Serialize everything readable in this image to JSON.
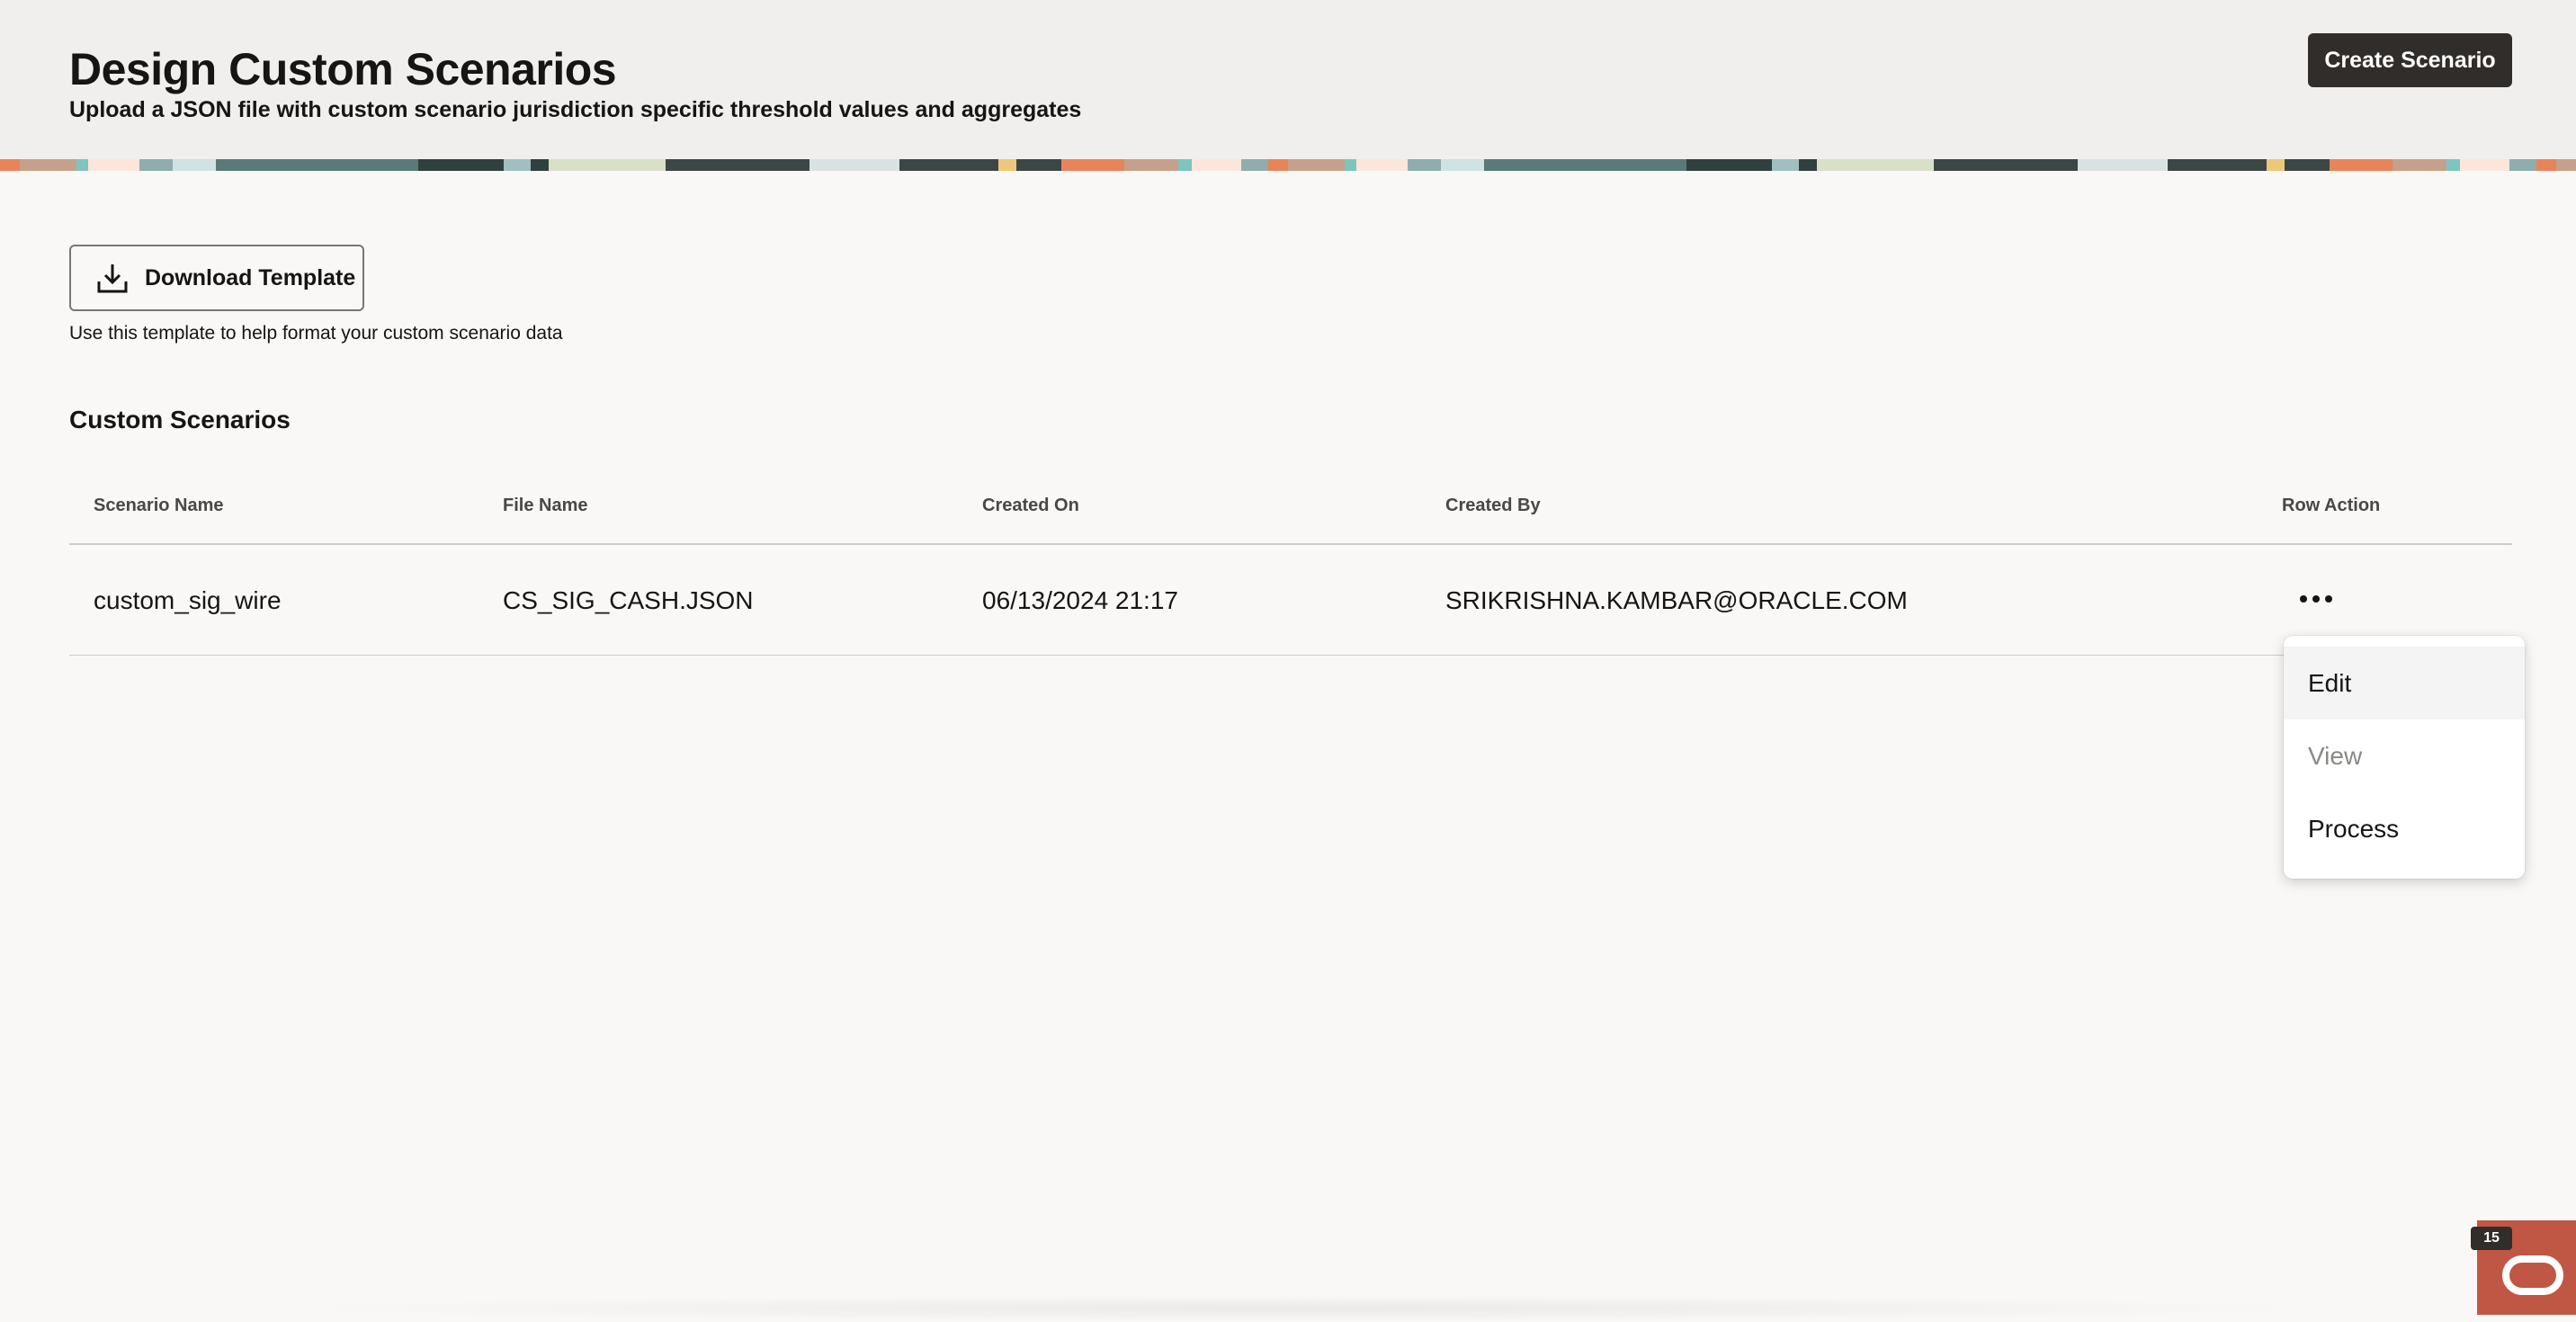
{
  "header": {
    "title": "Design Custom Scenarios",
    "subtitle": "Upload a JSON file with custom scenario jurisdiction specific threshold values and aggregates",
    "create_button": "Create Scenario"
  },
  "download": {
    "button_label": "Download Template",
    "icon": "download-icon",
    "helper_text": "Use this template to help format your custom scenario data"
  },
  "table": {
    "title": "Custom Scenarios",
    "columns": [
      "Scenario Name",
      "File Name",
      "Created On",
      "Created By",
      "Row Action"
    ],
    "rows": [
      {
        "scenario_name": "custom_sig_wire",
        "file_name": "CS_SIG_CASH.JSON",
        "created_on": "06/13/2024 21:17",
        "created_by": "SRIKRISHNA.KAMBAR@ORACLE.COM",
        "action_icon": "more-horizontal-icon"
      }
    ]
  },
  "row_menu": {
    "items": [
      {
        "label": "Edit",
        "state": "highlighted"
      },
      {
        "label": "View",
        "state": "disabled"
      },
      {
        "label": "Process",
        "state": "enabled"
      }
    ]
  },
  "assistant": {
    "badge_count": "15",
    "icon": "oracle-logo-icon",
    "color": "#c05744"
  },
  "colors": {
    "primary_button": "#312d2a",
    "header_bg": "#f1efed",
    "page_bg": "#f9f8f6"
  }
}
